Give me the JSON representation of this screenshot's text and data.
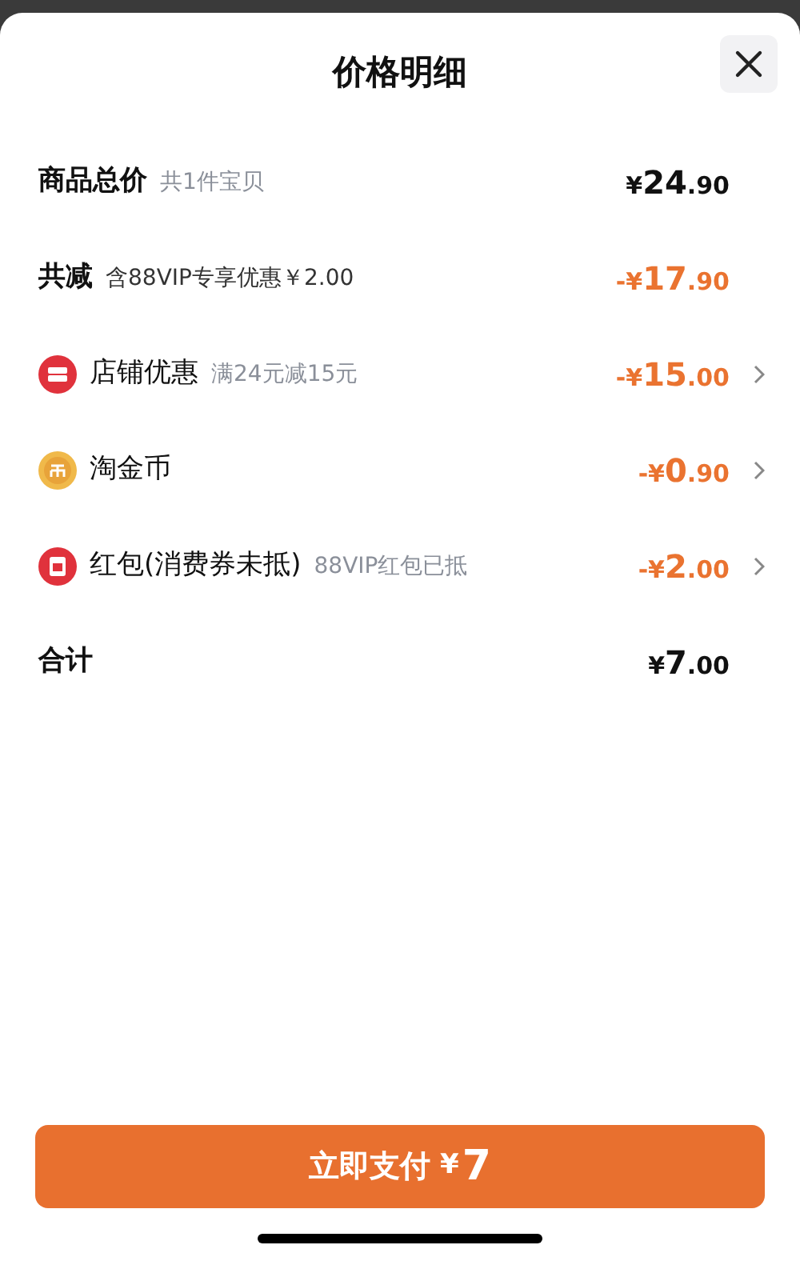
{
  "sheet": {
    "title": "价格明细"
  },
  "rows": [
    {
      "kind": "summary",
      "label": "商品总价",
      "note": "共1件宝贝",
      "chevron": false,
      "amount": {
        "prefix": "¥",
        "main": "24",
        "fraction": ".90",
        "color": "#111111"
      }
    },
    {
      "kind": "summary",
      "label": "共减",
      "note": "含88VIP专享优惠￥2.00",
      "chevron": false,
      "amount": {
        "prefix": "-¥",
        "main": "17",
        "fraction": ".90",
        "color": "#ea7330"
      }
    },
    {
      "kind": "shop",
      "label": "店铺优惠",
      "note": "满24元减15元",
      "chevron": true,
      "amount": {
        "prefix": "-¥",
        "main": "15",
        "fraction": ".00",
        "color": "#ea7330"
      }
    },
    {
      "kind": "coin",
      "label": "淘金币",
      "chevron": true,
      "amount": {
        "prefix": "-¥",
        "main": "0",
        "fraction": ".90",
        "color": "#ea7330"
      }
    },
    {
      "kind": "envelope",
      "label": "红包(消费券未抵)",
      "note": "88VIP红包已抵",
      "chevron": true,
      "amount": {
        "prefix": "-¥",
        "main": "2",
        "fraction": ".00",
        "color": "#ea7330"
      }
    },
    {
      "kind": "summary",
      "label": "合计",
      "chevron": false,
      "amount": {
        "prefix": "¥",
        "main": "7",
        "fraction": ".00",
        "color": "#111111"
      }
    }
  ],
  "pay_button": {
    "label": "立即支付",
    "prefix": "¥",
    "amount": "7"
  }
}
